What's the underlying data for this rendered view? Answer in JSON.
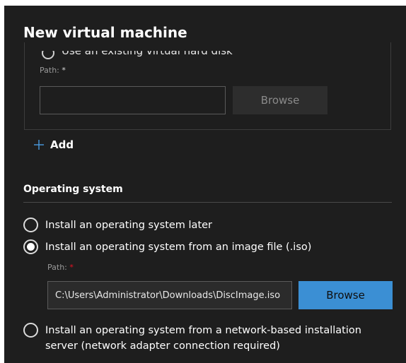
{
  "dialog": {
    "title": "New virtual machine"
  },
  "disk_section": {
    "use_existing_label": "Use an existing virtual hard disk",
    "path_label": "Path:",
    "path_required_marker": "*",
    "path_value": "",
    "browse_label": "Browse"
  },
  "add": {
    "icon": "plus-icon",
    "label": "Add"
  },
  "os_section": {
    "heading": "Operating system",
    "options": [
      {
        "label": "Install an operating system later",
        "selected": false
      },
      {
        "label": "Install an operating system from an image file (.iso)",
        "selected": true
      },
      {
        "label": "Install an operating system from a network-based installation server (network adapter connection required)",
        "selected": false
      }
    ],
    "iso_path_label": "Path:",
    "iso_path_required_marker": "*",
    "iso_path_value": "C:\\Users\\Administrator\\Downloads\\DiscImage.iso",
    "iso_browse_label": "Browse"
  },
  "colors": {
    "background": "#1e1e1e",
    "accent": "#3b8fd4",
    "required": "#e81123"
  }
}
